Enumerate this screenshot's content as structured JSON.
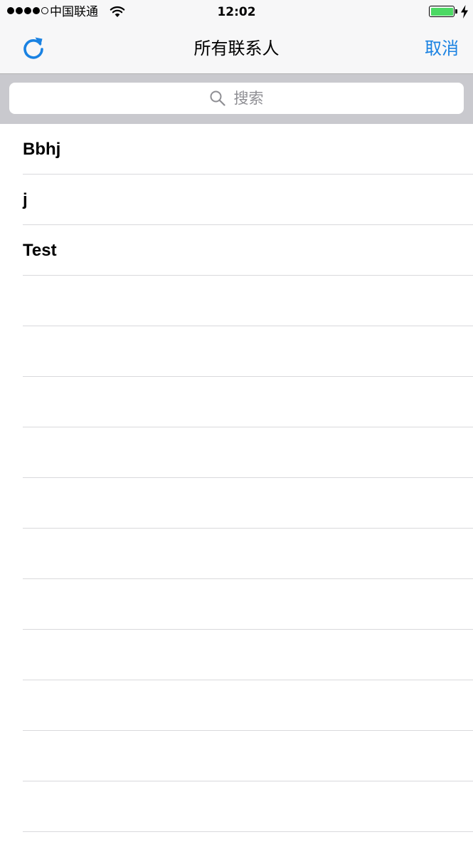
{
  "status_bar": {
    "signal_bars": 4,
    "signal_total": 5,
    "carrier": "中国联通",
    "time": "12:02",
    "battery_level": 1.0,
    "charging": true,
    "wifi_icon": "wifi-icon",
    "charge_icon": "bolt-icon"
  },
  "nav_bar": {
    "refresh_icon": "refresh-icon",
    "title": "所有联系人",
    "cancel_label": "取消",
    "accent_color": "#1a82e2"
  },
  "search": {
    "icon": "search-icon",
    "placeholder": "搜索"
  },
  "contacts": [
    {
      "name": "Bbhj"
    },
    {
      "name": "j"
    },
    {
      "name": "Test"
    },
    {
      "name": ""
    },
    {
      "name": ""
    },
    {
      "name": ""
    },
    {
      "name": ""
    },
    {
      "name": ""
    },
    {
      "name": ""
    },
    {
      "name": ""
    },
    {
      "name": ""
    },
    {
      "name": ""
    },
    {
      "name": ""
    },
    {
      "name": ""
    }
  ]
}
